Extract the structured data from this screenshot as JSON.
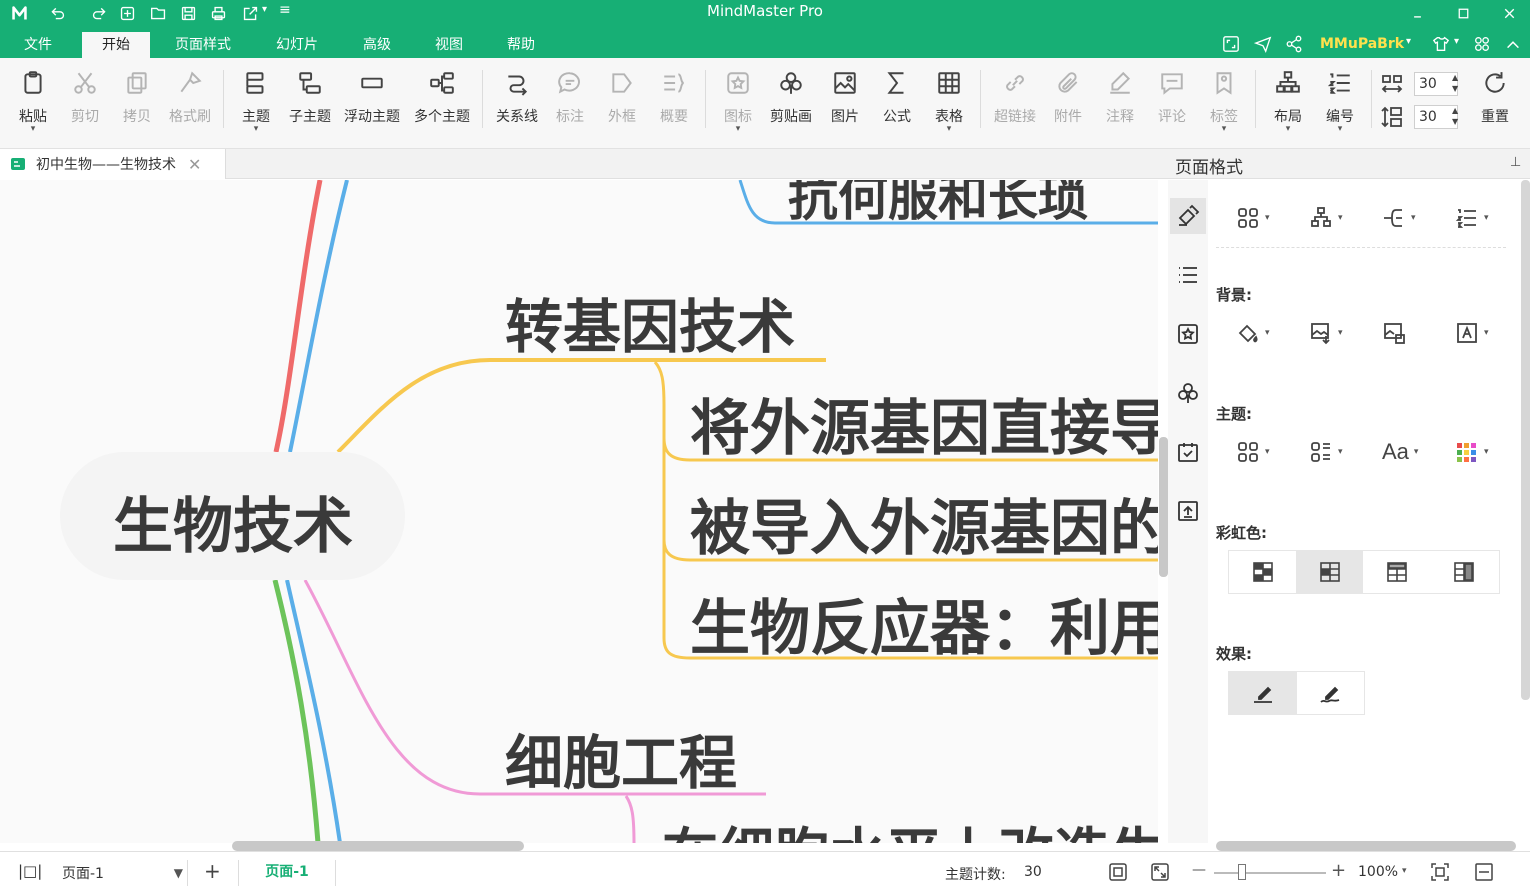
{
  "app": {
    "title": "MindMaster Pro",
    "user": "MMuPaBrk"
  },
  "menu": {
    "items": [
      "文件",
      "开始",
      "页面样式",
      "幻灯片",
      "高级",
      "视图",
      "帮助"
    ],
    "active": "开始"
  },
  "ribbon": {
    "paste": "粘贴",
    "cut": "剪切",
    "copy": "拷贝",
    "format_painter": "格式刷",
    "topic": "主题",
    "subtopic": "子主题",
    "floating_topic": "浮动主题",
    "multiple_topics": "多个主题",
    "relationship": "关系线",
    "callout": "标注",
    "boundary": "外框",
    "summary": "概要",
    "icon": "图标",
    "clipart": "剪贴画",
    "picture": "图片",
    "formula": "公式",
    "table": "表格",
    "hyperlink": "超链接",
    "attachment": "附件",
    "note": "注释",
    "comment": "评论",
    "tag": "标签",
    "layout": "布局",
    "numbering": "编号",
    "reset": "重置",
    "spacing_h": "30",
    "spacing_v": "30"
  },
  "document_tab": {
    "label": "初中生物——生物技术"
  },
  "mindmap": {
    "central": "生物技术",
    "top_cut": "抗何服和长琐",
    "branch1": "转基因技术",
    "b1_sub1": "将外源基因直接导",
    "b1_sub2": "被导入外源基因的",
    "b1_sub3": "生物反应器：利用",
    "branch2": "细胞工程",
    "b2_sub1": "在细胞水平上改造生"
  },
  "panel": {
    "title": "页面格式",
    "background_label": "背景:",
    "theme_label": "主题:",
    "rainbow_label": "彩虹色:",
    "effect_label": "效果:"
  },
  "status": {
    "page_select": "页面-1",
    "page_tab": "页面-1",
    "topic_count_label": "主题计数:",
    "topic_count": "30",
    "zoom": "100%"
  },
  "colors": {
    "brand": "#17af75",
    "branch_yellow": "#f7c84f",
    "branch_blue": "#5aaee8",
    "branch_red": "#ef6a6a",
    "branch_pink": "#f09ad6",
    "branch_green": "#6cc35a"
  }
}
